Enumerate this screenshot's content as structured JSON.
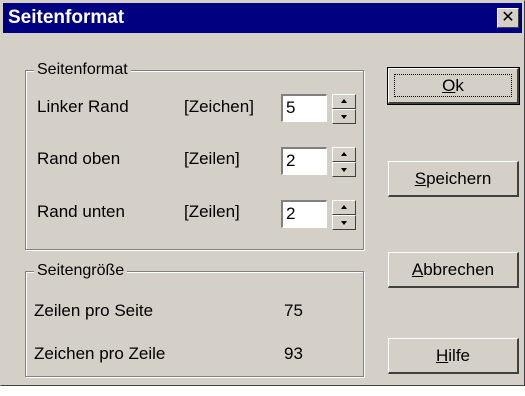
{
  "title": "Seitenformat",
  "close_glyph": "✕",
  "groups": {
    "format": {
      "label": "Seitenformat",
      "rows": [
        {
          "label": "Linker Rand",
          "unit": "[Zeichen]",
          "value": "5"
        },
        {
          "label": "Rand oben",
          "unit": "[Zeilen]",
          "value": "2"
        },
        {
          "label": "Rand unten",
          "unit": "[Zeilen]",
          "value": "2"
        }
      ]
    },
    "size": {
      "label": "Seitengröße",
      "rows": [
        {
          "label": "Zeilen pro Seite",
          "value": "75"
        },
        {
          "label": "Zeichen pro Zeile",
          "value": "93"
        }
      ]
    }
  },
  "buttons": {
    "ok": {
      "mn": "O",
      "rest": "k"
    },
    "save": {
      "mn": "S",
      "rest": "peichern"
    },
    "cancel": {
      "mn": "A",
      "rest": "bbrechen"
    },
    "help": {
      "mn": "H",
      "rest": "ilfe"
    }
  },
  "icons": {
    "close": "close-icon",
    "spin_up": "arrow-up-icon",
    "spin_down": "arrow-down-icon"
  },
  "colors": {
    "titlebar": "#000080",
    "face": "#d4d0c8"
  }
}
